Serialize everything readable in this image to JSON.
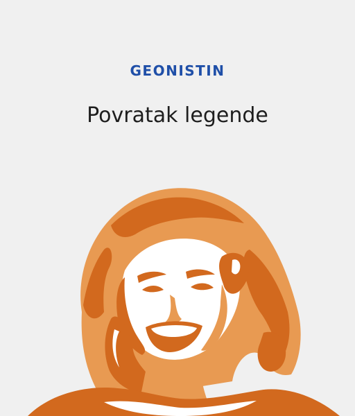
{
  "brand": {
    "name": "GEONISTIN",
    "color": "#1f4fa8"
  },
  "headline": "Povratak legende",
  "illustration": {
    "subject": "pop-art-portrait",
    "colors": {
      "dark_orange": "#d2691e",
      "light_orange": "#e89a52",
      "highlight": "#ffffff",
      "background": "#f0f0f0"
    }
  }
}
